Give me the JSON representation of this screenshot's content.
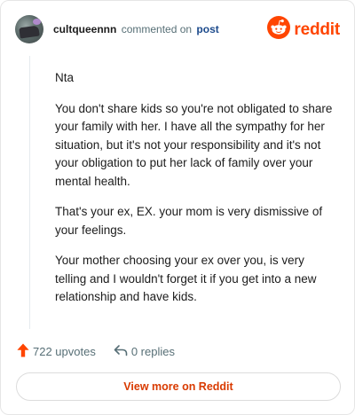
{
  "comment": {
    "username": "cultqueennn",
    "action_text": "commented on",
    "target_text": "post",
    "paragraphs": [
      "Nta",
      "You don't share kids so you're not obligated to share your family with her. I have all the sympathy for her situation, but it's not your responsibility and it's not your obligation to put her lack of family over your mental health.",
      "That's your ex, EX. your mom is very dismissive of your feelings.",
      "Your mother choosing your ex over you, is very telling and I wouldn't forget it if you get into a new relationship and have kids."
    ]
  },
  "brand": {
    "label": "reddit",
    "icon": "reddit-snoo-icon",
    "color": "#ff4500"
  },
  "stats": {
    "upvotes_label": "722 upvotes",
    "replies_label": "0 replies",
    "upvote_icon": "upvote-arrow-icon",
    "reply_icon": "reply-arrow-icon",
    "upvote_color": "#ff4500"
  },
  "view_more": {
    "label": "View more on Reddit"
  }
}
